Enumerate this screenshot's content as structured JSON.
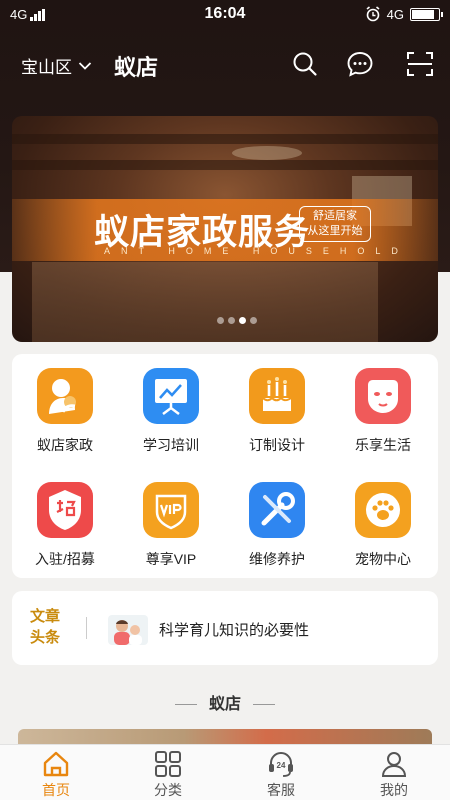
{
  "status_bar": {
    "network_left": "4G",
    "time": "16:04",
    "network_right": "4G",
    "battery_level": 0.92
  },
  "header": {
    "location": "宝山区",
    "title": "蚁店",
    "icons": [
      "search-icon",
      "message-icon",
      "scan-icon"
    ]
  },
  "banner": {
    "title": "蚁店家政服务",
    "subtitle": "ANT HOME HOUSEHOLD",
    "tag_line1": "舒适居家",
    "tag_line2": "从这里开始",
    "slide_count": 4,
    "active_slide": 3
  },
  "categories": [
    {
      "label": "蚁店家政",
      "icon": "mother-child-icon",
      "color": "#f39a1e"
    },
    {
      "label": "学习培训",
      "icon": "presentation-board-icon",
      "color": "#2e8df2"
    },
    {
      "label": "订制设计",
      "icon": "cake-icon",
      "color": "#f29a1c"
    },
    {
      "label": "乐享生活",
      "icon": "face-mask-icon",
      "color": "#f05a5a"
    },
    {
      "label": "入驻/招募",
      "icon": "recruit-badge-icon",
      "color": "#ee4a4a"
    },
    {
      "label": "尊享VIP",
      "icon": "vip-shield-icon",
      "color": "#f4a11f"
    },
    {
      "label": "维修养护",
      "icon": "tools-icon",
      "color": "#2f86f0"
    },
    {
      "label": "宠物中心",
      "icon": "paw-icon",
      "color": "#f4a11f"
    }
  ],
  "news": {
    "label_line1": "文章",
    "label_line2": "头条",
    "title": "科学育儿知识的必要性"
  },
  "section": {
    "title": "蚁店"
  },
  "tabbar": [
    {
      "label": "首页",
      "icon": "home-icon",
      "active": true
    },
    {
      "label": "分类",
      "icon": "category-grid-icon",
      "active": false
    },
    {
      "label": "客服",
      "icon": "headset-24-icon",
      "active": false
    },
    {
      "label": "我的",
      "icon": "profile-icon",
      "active": false
    }
  ],
  "colors": {
    "accent": "#e8860f",
    "header_bg": "#221613",
    "news_label": "#c98b0e"
  }
}
